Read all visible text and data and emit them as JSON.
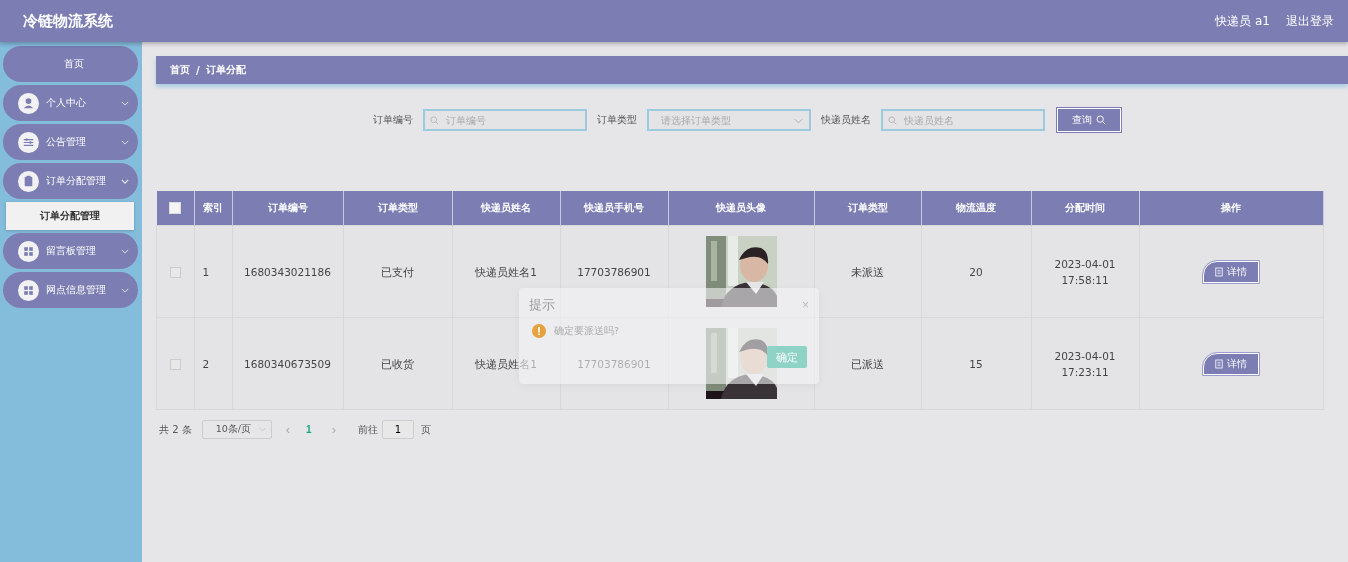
{
  "header": {
    "title": "冷链物流系统",
    "user": "快递员 a1",
    "logout": "退出登录"
  },
  "sidebar": {
    "items": [
      {
        "label": "首页"
      },
      {
        "label": "个人中心",
        "expanded": false
      },
      {
        "label": "公告管理",
        "expanded": false
      },
      {
        "label": "订单分配管理",
        "expanded": true,
        "children": [
          {
            "label": "订单分配管理",
            "selected": true
          }
        ]
      },
      {
        "label": "留言板管理",
        "expanded": false
      },
      {
        "label": "网点信息管理",
        "expanded": false
      }
    ]
  },
  "breadcrumb": [
    "首页",
    "/",
    "订单分配"
  ],
  "search": {
    "fields": [
      {
        "label": "订单编号",
        "kind": "text",
        "placeholder": "订单编号"
      },
      {
        "label": "订单类型",
        "kind": "select",
        "placeholder": "请选择订单类型"
      },
      {
        "label": "快递员姓名",
        "kind": "text",
        "placeholder": "快递员姓名"
      }
    ],
    "button": "查询"
  },
  "table": {
    "select_all": {
      "checked": false
    },
    "columns": [
      "索引",
      "订单编号",
      "订单类型",
      "快递员姓名",
      "快递员手机号",
      "快递员头像",
      "订单类型",
      "物流温度",
      "分配时间",
      "操作"
    ],
    "rows": [
      {
        "checked": false,
        "cells": [
          "1",
          "1680343021186",
          "已支付",
          "快递员姓名1",
          "17703786901",
          {
            "kind": "picture"
          },
          "未派送",
          "20",
          "2023-04-01 17:58:11"
        ],
        "action": "详情"
      },
      {
        "checked": false,
        "cells": [
          "2",
          "1680340673509",
          "已收货",
          "快递员姓名1",
          "17703786901",
          {
            "kind": "picture"
          },
          "已派送",
          "15",
          "2023-04-01 17:23:11"
        ],
        "action": "详情"
      }
    ]
  },
  "pagination": {
    "total": "共 2 条",
    "page_size": "10条/页",
    "prev": "‹",
    "pages": [
      {
        "label": "1",
        "selected": true
      }
    ],
    "next": "›",
    "goto_label": "前往",
    "goto_value": "1",
    "goto_suffix": "页"
  },
  "dialog": {
    "title": "提示",
    "close": "×",
    "message": "确定要派送吗?",
    "confirm": "确定"
  }
}
